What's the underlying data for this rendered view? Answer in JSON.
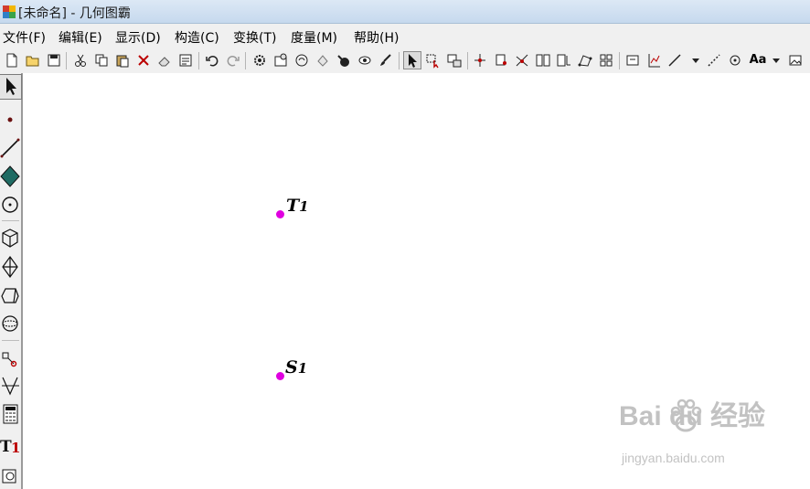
{
  "window": {
    "title": "[未命名] - 几何图霸"
  },
  "menu": [
    {
      "id": "file",
      "label": "文件(F)"
    },
    {
      "id": "edit",
      "label": "编辑(E)"
    },
    {
      "id": "display",
      "label": "显示(D)"
    },
    {
      "id": "construct",
      "label": "构造(C)"
    },
    {
      "id": "transform",
      "label": "变换(T)"
    },
    {
      "id": "measure",
      "label": "度量(M)"
    },
    {
      "id": "help",
      "label": "帮助(H)"
    }
  ],
  "toolbar": {
    "icons": [
      "new-file-icon",
      "open-folder-icon",
      "save-icon",
      "cut-icon",
      "copy-icon",
      "paste-icon",
      "delete-icon",
      "eraser-icon",
      "properties-icon",
      "undo-icon",
      "redo-icon",
      "settings-icon",
      "toolbar-config-icon",
      "animate-icon",
      "color-fill-icon",
      "trace-icon",
      "hide-icon",
      "brush-icon",
      "arrow-select-icon",
      "select-rect-icon",
      "select-group-icon",
      "point-on-object-icon",
      "midpoint-icon",
      "intersect-icon",
      "parallel-icon",
      "perpendicular-icon",
      "polygon-icon",
      "grid-icon",
      "label-box-icon",
      "coordinate-icon",
      "line-icon",
      "dropdown-arrow-icon",
      "dotted-line-icon",
      "circle-point-icon",
      "text-style-icon",
      "dropdown-arrow-icon",
      "image-icon"
    ],
    "text_style_label": "Aa",
    "active": "arrow-select-icon"
  },
  "toolbox": {
    "items": [
      "arrow-tool-icon",
      "point-tool-icon",
      "segment-tool-icon",
      "polygon-tool-icon",
      "circle-tool-icon",
      "cube-tool-icon",
      "octahedron-tool-icon",
      "prism-tool-icon",
      "sphere-tool-icon",
      "transform-tool-icon",
      "graph-tool-icon",
      "calculator-tool-icon",
      "text-tool-icon",
      "image-tool-icon"
    ],
    "text_tool_label": "T",
    "text_tool_sub": "1",
    "active": "arrow-tool-icon"
  },
  "canvas": {
    "points": [
      {
        "name": "T",
        "sub": "1",
        "color": "#e000e0"
      },
      {
        "name": "S",
        "sub": "1",
        "color": "#e000e0"
      }
    ]
  },
  "watermark": {
    "brand": "Bai du 经验",
    "url": "jingyan.baidu.com"
  },
  "colors": {
    "point": "#e000e0",
    "menubar": "#f0f0f0",
    "titlebar": "#c6d9ee"
  }
}
